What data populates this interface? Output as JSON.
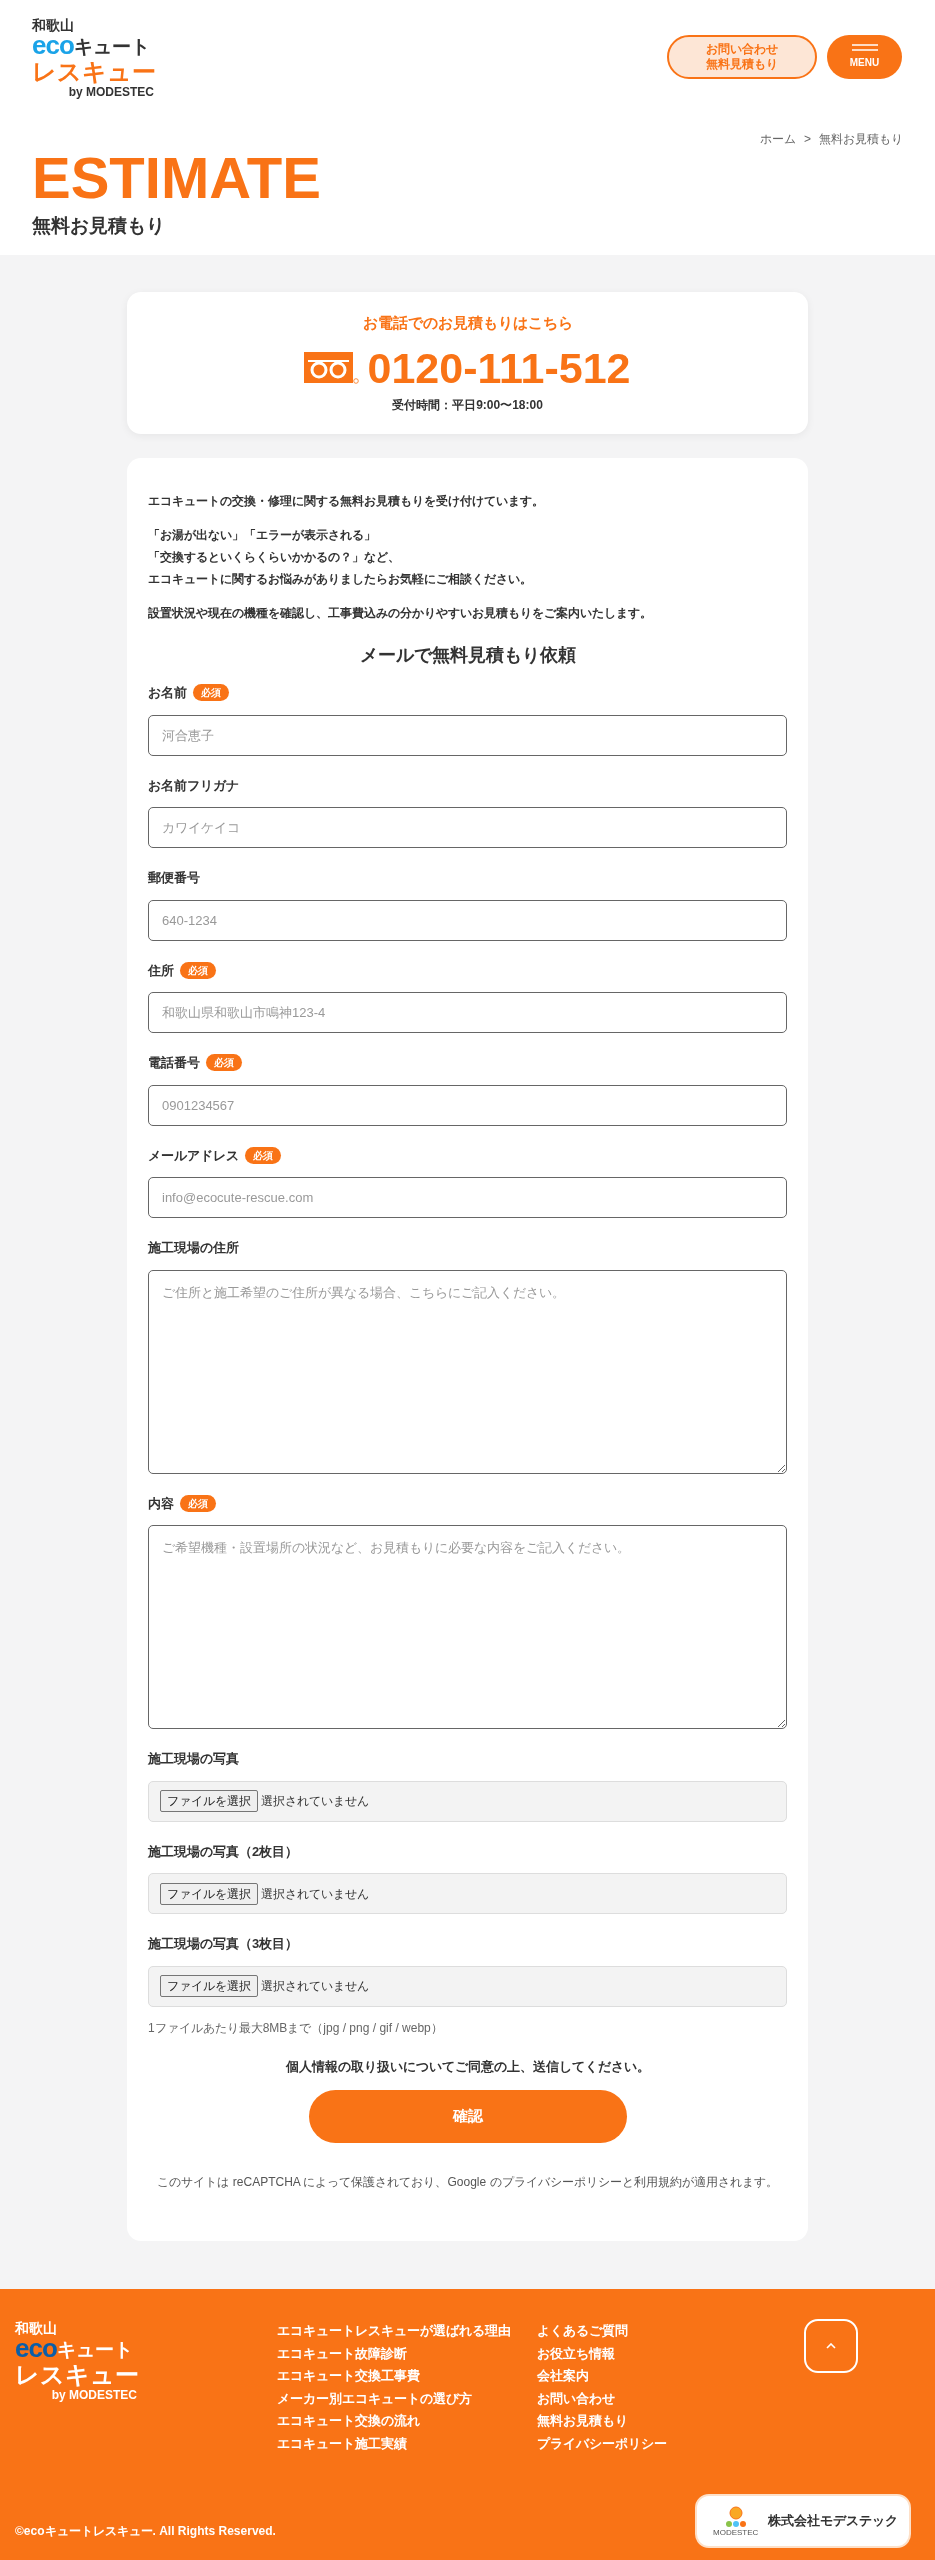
{
  "header": {
    "logo": {
      "region": "和歌山",
      "eco": "eco",
      "product": "キュート",
      "rescue": "レスキュー",
      "by": "by MODESTEC"
    },
    "contact_button": [
      "お問い合わせ",
      "無料見積もり"
    ],
    "menu_button": "MENU"
  },
  "breadcrumb": [
    "ホーム",
    ">",
    "無料お見積もり"
  ],
  "page_title": {
    "en": "ESTIMATE",
    "ja": "無料お見積もり"
  },
  "phone_card": {
    "heading": "お電話でのお見積もりはこちら",
    "number": "0120-111-512",
    "hours": "受付時間：平日9:00〜18:00"
  },
  "intro": [
    "エコキュートの交換・修理に関する無料お見積もりを受け付けています。",
    [
      "「お湯が出ない」「エラーが表示される」",
      "「交換するといくらくらいかかるの？」など、",
      "エコキュートに関するお悩みがありましたらお気軽にご相談ください。"
    ],
    "設置状況や現在の機種を確認し、工事費込みの分かりやすいお見積もりをご案内いたします。"
  ],
  "form": {
    "title": "メールで無料見積もり依頼",
    "fields": [
      {
        "kind": "text",
        "label": "お名前",
        "badge": "必須",
        "placeholder": "河合恵子"
      },
      {
        "kind": "text",
        "label": "お名前フリガナ",
        "placeholder": "カワイケイコ"
      },
      {
        "kind": "text",
        "label": "郵便番号",
        "placeholder": "640-1234"
      },
      {
        "kind": "text",
        "label": "住所",
        "badge": "必須",
        "placeholder": "和歌山県和歌山市鳴神123-4"
      },
      {
        "kind": "text",
        "label": "電話番号",
        "badge": "必須",
        "placeholder": "0901234567"
      },
      {
        "kind": "text",
        "label": "メールアドレス",
        "badge": "必須",
        "placeholder": "info@ecocute-rescue.com"
      },
      {
        "kind": "textarea",
        "label": "施工現場の住所",
        "placeholder": "ご住所と施工希望のご住所が異なる場合、こちらにご記入ください。"
      },
      {
        "kind": "textarea",
        "label": "内容",
        "badge": "必須",
        "placeholder": "ご希望機種・設置場所の状況など、お見積もりに必要な内容をご記入ください。"
      },
      {
        "kind": "file",
        "label": "施工現場の写真",
        "button": "ファイルを選択",
        "status": "選択されていません"
      },
      {
        "kind": "file",
        "label": "施工現場の写真（2枚目）",
        "button": "ファイルを選択",
        "status": "選択されていません"
      },
      {
        "kind": "file",
        "label": "施工現場の写真（3枚目）",
        "button": "ファイルを選択",
        "status": "選択されていません"
      }
    ],
    "file_note": "1ファイルあたり最大8MBまで（jpg / png / gif / webp）",
    "consent": "個人情報の取り扱いについてご同意の上、送信してください。",
    "submit": "確認",
    "recaptcha": "このサイトは reCAPTCHA によって保護されており、Google のプライバシーポリシーと利用規約が適用されます。"
  },
  "footer": {
    "logo": {
      "region": "和歌山",
      "eco": "eco",
      "product": "キュート",
      "rescue": "レスキュー",
      "by": "by MODESTEC"
    },
    "links_1": [
      "エコキュートレスキューが選ばれる理由",
      "エコキュート故障診断",
      "エコキュート交換工事費",
      "メーカー別エコキュートの選び方",
      "エコキュート交換の流れ",
      "エコキュート施工実績"
    ],
    "links_2": [
      "よくあるご質問",
      "お役立ち情報",
      "会社案内",
      "お問い合わせ",
      "無料お見積もり",
      "プライバシーポリシー"
    ],
    "company": {
      "logo_caption": "MODESTEC",
      "name": "株式会社モデステック"
    },
    "copyright": "©ecoキュートレスキュー. All Rights Reserved."
  }
}
